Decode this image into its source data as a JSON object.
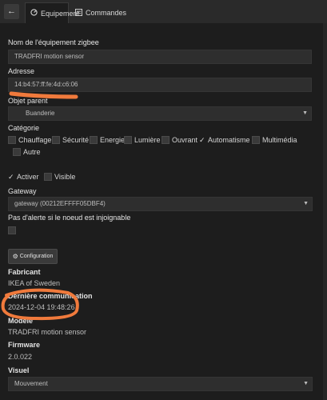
{
  "tabs": [
    {
      "label": "Equipement",
      "icon": "gauge-icon"
    },
    {
      "label": "Commandes",
      "icon": "list-icon"
    }
  ],
  "form": {
    "name_label": "Nom de l'équipement zigbee",
    "name_value": "TRADFRI motion sensor",
    "address_label": "Adresse",
    "address_value": "14:b4:57:ff:fe:4d:c6:06",
    "parent_label": "Objet parent",
    "parent_value": "Buanderie",
    "category_label": "Catégorie",
    "categories": [
      {
        "label": "Chauffage",
        "checked": false
      },
      {
        "label": "Sécurité",
        "checked": false
      },
      {
        "label": "Energie",
        "checked": false
      },
      {
        "label": "Lumière",
        "checked": false
      },
      {
        "label": "Ouvrant",
        "checked": false
      },
      {
        "label": "Automatisme",
        "checked": true
      },
      {
        "label": "Multimédia",
        "checked": false
      },
      {
        "label": "Autre",
        "checked": false
      }
    ],
    "activate_label": "Activer",
    "activate_checked": true,
    "visible_label": "Visible",
    "visible_checked": false,
    "gateway_label": "Gateway",
    "gateway_value": "gateway (00212EFFFF05DBF4)",
    "no_alert_label": "Pas d'alerte si le noeud est injoignable",
    "config_button": "Configuration",
    "manufacturer_label": "Fabricant",
    "manufacturer_value": "IKEA of Sweden",
    "last_comm_label": "Dernière communication",
    "last_comm_value": "2024-12-04 19:48:26",
    "model_label": "Modèle",
    "model_value": "TRADFRI motion sensor",
    "firmware_label": "Firmware",
    "firmware_value": "2.0.022",
    "visual_label": "Visuel",
    "visual_value": "Mouvement"
  },
  "colors": {
    "background": "#1d1d1d",
    "annotation": "#f07a3c"
  }
}
